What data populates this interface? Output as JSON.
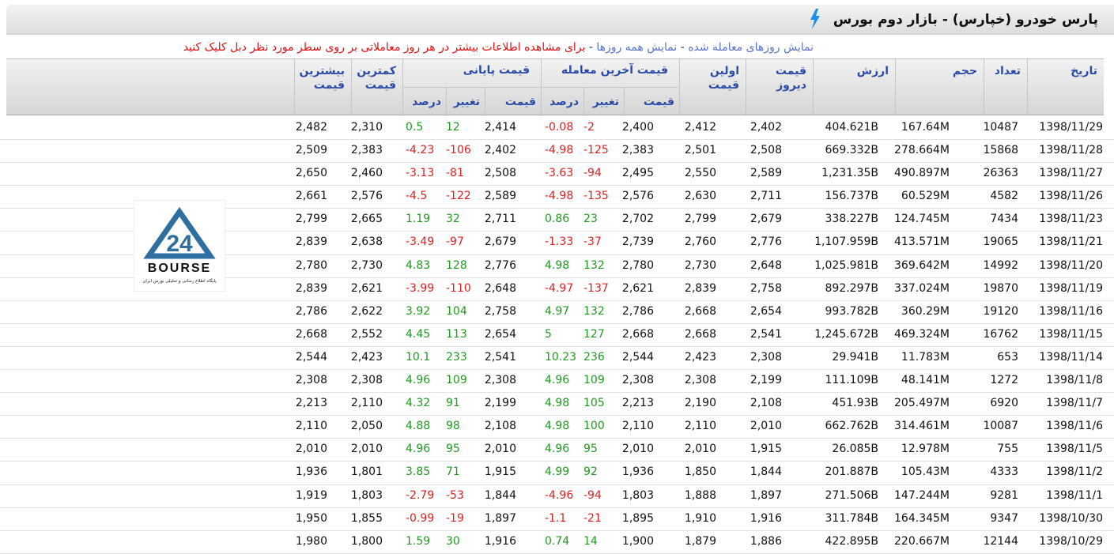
{
  "header": {
    "title": "پارس خودرو (خپارس) - بازار دوم بورس"
  },
  "info": {
    "link_traded": "نمایش روزهای معامله شده",
    "link_all": "نمایش همه روزها",
    "hint": "برای مشاهده اطلاعات بیشتر در هر روز معاملاتی بر روی سطر مورد نظر دبل کلیک کنید",
    "dash": "-"
  },
  "columns": {
    "date": "تاریخ",
    "count": "تعداد",
    "volume": "حجم",
    "value": "ارزش",
    "yesterday": "قیمت دیروز",
    "first": "اولین قیمت",
    "last_trade_group": "قیمت آخرین معامله",
    "closing_group": "قیمت پایانی",
    "price": "قیمت",
    "change": "تغییر",
    "percent": "درصد",
    "lowest": "کمترین قیمت",
    "highest": "بیشترین قیمت"
  },
  "logo": {
    "number": "24",
    "word": "BOURSE",
    "tagline": "پایگاه اطلاع رسانی و تحلیلی بورس ایران"
  },
  "colors": {
    "positive": "#1f9a1f",
    "negative": "#e02020",
    "header_text": "#2c4aa8",
    "link": "#5a73c8"
  },
  "rows": [
    {
      "date": "1398/11/29",
      "count": "10487",
      "volume": "167.64M",
      "value": "404.621B",
      "yesterday": "2,402",
      "first": "2,412",
      "last_price": "2,400",
      "last_change": "-2",
      "last_pct": "-0.08",
      "close_price": "2,414",
      "close_change": "12",
      "close_pct": "0.5",
      "low": "2,310",
      "high": "2,482"
    },
    {
      "date": "1398/11/28",
      "count": "15868",
      "volume": "278.664M",
      "value": "669.332B",
      "yesterday": "2,508",
      "first": "2,501",
      "last_price": "2,383",
      "last_change": "-125",
      "last_pct": "-4.98",
      "close_price": "2,402",
      "close_change": "-106",
      "close_pct": "-4.23",
      "low": "2,383",
      "high": "2,509"
    },
    {
      "date": "1398/11/27",
      "count": "26363",
      "volume": "490.897M",
      "value": "1,231.35B",
      "yesterday": "2,589",
      "first": "2,550",
      "last_price": "2,495",
      "last_change": "-94",
      "last_pct": "-3.63",
      "close_price": "2,508",
      "close_change": "-81",
      "close_pct": "-3.13",
      "low": "2,460",
      "high": "2,650"
    },
    {
      "date": "1398/11/26",
      "count": "4582",
      "volume": "60.529M",
      "value": "156.737B",
      "yesterday": "2,711",
      "first": "2,630",
      "last_price": "2,576",
      "last_change": "-135",
      "last_pct": "-4.98",
      "close_price": "2,589",
      "close_change": "-122",
      "close_pct": "-4.5",
      "low": "2,576",
      "high": "2,661"
    },
    {
      "date": "1398/11/23",
      "count": "7434",
      "volume": "124.745M",
      "value": "338.227B",
      "yesterday": "2,679",
      "first": "2,799",
      "last_price": "2,702",
      "last_change": "23",
      "last_pct": "0.86",
      "close_price": "2,711",
      "close_change": "32",
      "close_pct": "1.19",
      "low": "2,665",
      "high": "2,799"
    },
    {
      "date": "1398/11/21",
      "count": "19065",
      "volume": "413.571M",
      "value": "1,107.959B",
      "yesterday": "2,776",
      "first": "2,760",
      "last_price": "2,739",
      "last_change": "-37",
      "last_pct": "-1.33",
      "close_price": "2,679",
      "close_change": "-97",
      "close_pct": "-3.49",
      "low": "2,638",
      "high": "2,839"
    },
    {
      "date": "1398/11/20",
      "count": "14992",
      "volume": "369.642M",
      "value": "1,025.981B",
      "yesterday": "2,648",
      "first": "2,730",
      "last_price": "2,780",
      "last_change": "132",
      "last_pct": "4.98",
      "close_price": "2,776",
      "close_change": "128",
      "close_pct": "4.83",
      "low": "2,730",
      "high": "2,780"
    },
    {
      "date": "1398/11/19",
      "count": "19870",
      "volume": "337.024M",
      "value": "892.297B",
      "yesterday": "2,758",
      "first": "2,839",
      "last_price": "2,621",
      "last_change": "-137",
      "last_pct": "-4.97",
      "close_price": "2,648",
      "close_change": "-110",
      "close_pct": "-3.99",
      "low": "2,621",
      "high": "2,839"
    },
    {
      "date": "1398/11/16",
      "count": "19120",
      "volume": "360.29M",
      "value": "993.782B",
      "yesterday": "2,654",
      "first": "2,668",
      "last_price": "2,786",
      "last_change": "132",
      "last_pct": "4.97",
      "close_price": "2,758",
      "close_change": "104",
      "close_pct": "3.92",
      "low": "2,622",
      "high": "2,786"
    },
    {
      "date": "1398/11/15",
      "count": "16762",
      "volume": "469.324M",
      "value": "1,245.672B",
      "yesterday": "2,541",
      "first": "2,668",
      "last_price": "2,668",
      "last_change": "127",
      "last_pct": "5",
      "close_price": "2,654",
      "close_change": "113",
      "close_pct": "4.45",
      "low": "2,552",
      "high": "2,668"
    },
    {
      "date": "1398/11/14",
      "count": "653",
      "volume": "11.783M",
      "value": "29.941B",
      "yesterday": "2,308",
      "first": "2,423",
      "last_price": "2,544",
      "last_change": "236",
      "last_pct": "10.23",
      "close_price": "2,541",
      "close_change": "233",
      "close_pct": "10.1",
      "low": "2,423",
      "high": "2,544"
    },
    {
      "date": "1398/11/8",
      "count": "1272",
      "volume": "48.141M",
      "value": "111.109B",
      "yesterday": "2,199",
      "first": "2,308",
      "last_price": "2,308",
      "last_change": "109",
      "last_pct": "4.96",
      "close_price": "2,308",
      "close_change": "109",
      "close_pct": "4.96",
      "low": "2,308",
      "high": "2,308"
    },
    {
      "date": "1398/11/7",
      "count": "6920",
      "volume": "205.497M",
      "value": "451.93B",
      "yesterday": "2,108",
      "first": "2,190",
      "last_price": "2,213",
      "last_change": "105",
      "last_pct": "4.98",
      "close_price": "2,199",
      "close_change": "91",
      "close_pct": "4.32",
      "low": "2,110",
      "high": "2,213"
    },
    {
      "date": "1398/11/6",
      "count": "10087",
      "volume": "314.461M",
      "value": "662.762B",
      "yesterday": "2,010",
      "first": "2,110",
      "last_price": "2,110",
      "last_change": "100",
      "last_pct": "4.98",
      "close_price": "2,108",
      "close_change": "98",
      "close_pct": "4.88",
      "low": "2,050",
      "high": "2,110"
    },
    {
      "date": "1398/11/5",
      "count": "755",
      "volume": "12.978M",
      "value": "26.085B",
      "yesterday": "1,915",
      "first": "2,010",
      "last_price": "2,010",
      "last_change": "95",
      "last_pct": "4.96",
      "close_price": "2,010",
      "close_change": "95",
      "close_pct": "4.96",
      "low": "2,010",
      "high": "2,010"
    },
    {
      "date": "1398/11/2",
      "count": "4333",
      "volume": "105.43M",
      "value": "201.887B",
      "yesterday": "1,844",
      "first": "1,850",
      "last_price": "1,936",
      "last_change": "92",
      "last_pct": "4.99",
      "close_price": "1,915",
      "close_change": "71",
      "close_pct": "3.85",
      "low": "1,801",
      "high": "1,936"
    },
    {
      "date": "1398/11/1",
      "count": "9281",
      "volume": "147.244M",
      "value": "271.506B",
      "yesterday": "1,897",
      "first": "1,888",
      "last_price": "1,803",
      "last_change": "-94",
      "last_pct": "-4.96",
      "close_price": "1,844",
      "close_change": "-53",
      "close_pct": "-2.79",
      "low": "1,803",
      "high": "1,919"
    },
    {
      "date": "1398/10/30",
      "count": "9347",
      "volume": "164.345M",
      "value": "311.784B",
      "yesterday": "1,916",
      "first": "1,910",
      "last_price": "1,895",
      "last_change": "-21",
      "last_pct": "-1.1",
      "close_price": "1,897",
      "close_change": "-19",
      "close_pct": "-0.99",
      "low": "1,855",
      "high": "1,950"
    },
    {
      "date": "1398/10/29",
      "count": "12144",
      "volume": "220.667M",
      "value": "422.895B",
      "yesterday": "1,886",
      "first": "1,879",
      "last_price": "1,900",
      "last_change": "14",
      "last_pct": "0.74",
      "close_price": "1,916",
      "close_change": "30",
      "close_pct": "1.59",
      "low": "1,800",
      "high": "1,980"
    }
  ]
}
